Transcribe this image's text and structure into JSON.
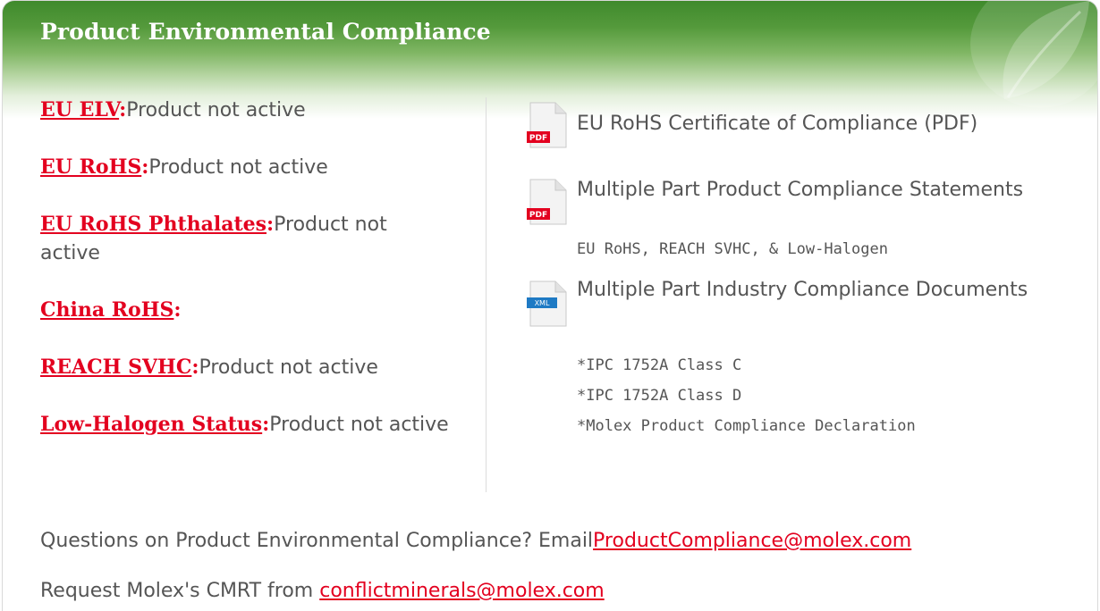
{
  "header": {
    "title": "Product Environmental Compliance"
  },
  "compliance_items": [
    {
      "label": "EU ELV",
      "separator": ":",
      "status": "Product not active"
    },
    {
      "label": "EU RoHS",
      "separator": ":",
      "status": "Product not active"
    },
    {
      "label": "EU RoHS Phthalates",
      "separator": ":",
      "status": "Product not active"
    },
    {
      "label": "China RoHS",
      "separator": ":",
      "status": ""
    },
    {
      "label": "REACH SVHC",
      "separator": ":",
      "status": "Product not active"
    },
    {
      "label": "Low-Halogen Status",
      "separator": ":",
      "status": "Product not active"
    }
  ],
  "documents": [
    {
      "title": "EU RoHS Certificate of Compliance (PDF)",
      "icon": "pdf-file-icon",
      "icon_text": "PDF"
    },
    {
      "title": "Multiple Part Product Compliance Statements",
      "subtitle": "EU RoHS, REACH SVHC, & Low-Halogen",
      "icon": "pdf-file-icon",
      "icon_text": "PDF"
    },
    {
      "title": "Multiple Part Industry Compliance Documents",
      "icon": "xml-file-icon",
      "icon_text": "XML"
    }
  ],
  "industry_docs": [
    "*IPC 1752A Class C",
    "*IPC 1752A Class D",
    "*Molex Product Compliance Declaration"
  ],
  "footer": {
    "questions_text": "Questions on Product Environmental Compliance? Email",
    "questions_email": "ProductCompliance@molex.com",
    "cmrt_text": "Request Molex's CMRT from ",
    "cmrt_email": "conflictminerals@molex.com"
  },
  "colors": {
    "link": "#e3001f",
    "header_green": "#3f8a2c",
    "text": "#555555",
    "pdf_badge": "#e3001f",
    "xml_badge": "#1e7ac4"
  }
}
